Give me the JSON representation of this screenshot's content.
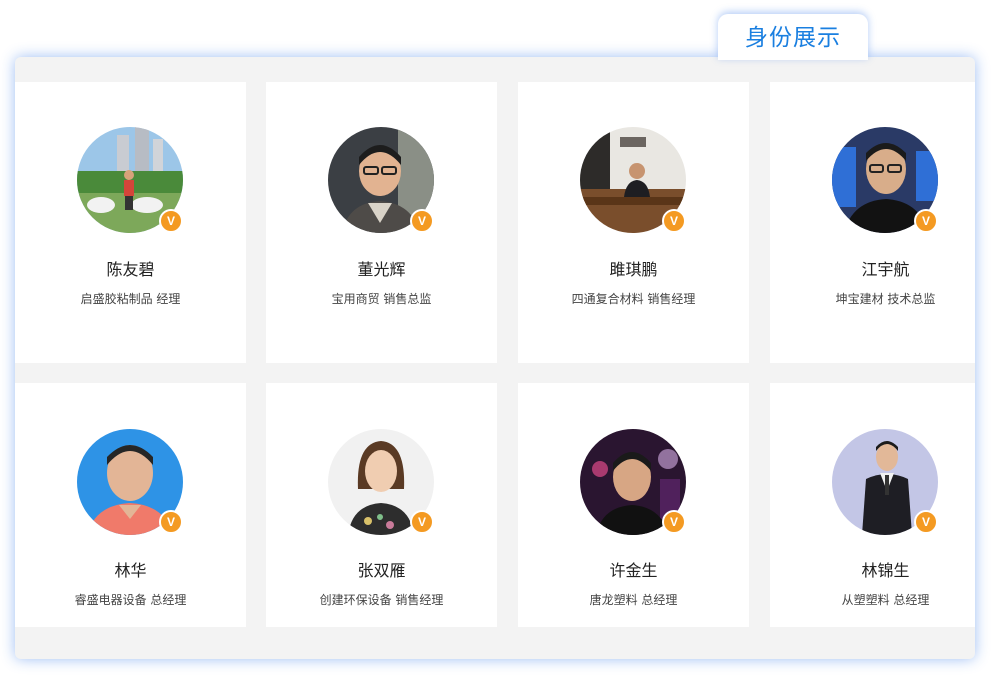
{
  "section": {
    "tab_label": "身份展示"
  },
  "members": [
    {
      "name": "陈友碧",
      "title": "启盛胶粘制品 经理",
      "badge": "V",
      "avatar_icon": "person-photo-icon"
    },
    {
      "name": "董光辉",
      "title": "宝用商贸 销售总监",
      "badge": "V",
      "avatar_icon": "person-photo-icon"
    },
    {
      "name": "雎琪鹏",
      "title": "四通复合材料 销售经理",
      "badge": "V",
      "avatar_icon": "person-photo-icon"
    },
    {
      "name": "江宇航",
      "title": "坤宝建材 技术总监",
      "badge": "V",
      "avatar_icon": "person-photo-icon"
    },
    {
      "name": "林华",
      "title": "睿盛电器设备 总经理",
      "badge": "V",
      "avatar_icon": "person-photo-icon"
    },
    {
      "name": "张双雁",
      "title": "创建环保设备 销售经理",
      "badge": "V",
      "avatar_icon": "person-photo-icon"
    },
    {
      "name": "许金生",
      "title": "唐龙塑料 总经理",
      "badge": "V",
      "avatar_icon": "person-photo-icon"
    },
    {
      "name": "林锦生",
      "title": "从塑塑料 总经理",
      "badge": "V",
      "avatar_icon": "person-photo-icon"
    }
  ],
  "colors": {
    "accent": "#1a7fe0",
    "badge": "#f49a22",
    "panel_bg": "#f3f3f3",
    "card_bg": "#ffffff"
  }
}
